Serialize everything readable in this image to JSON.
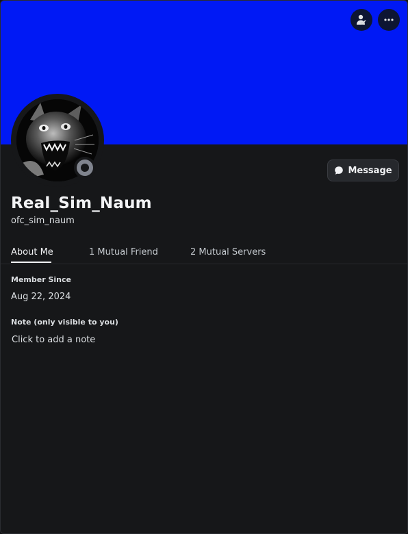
{
  "colors": {
    "banner": "#0019f5",
    "background": "#161719",
    "status_offline": "#80848e"
  },
  "banner": {
    "friend_button_icon": "add-friend-icon",
    "more_button_icon": "more-options-icon"
  },
  "profile": {
    "display_name": "Real_Sim_Naum",
    "username": "ofc_sim_naum",
    "status": "offline"
  },
  "actions": {
    "message_label": "Message",
    "message_icon": "chat-bubble-icon"
  },
  "tabs": [
    {
      "label": "About Me",
      "active": true
    },
    {
      "label": "1 Mutual Friend",
      "active": false
    },
    {
      "label": "2 Mutual Servers",
      "active": false
    }
  ],
  "about": {
    "member_since_label": "Member Since",
    "member_since_value": "Aug 22, 2024",
    "note_label": "Note (only visible to you)",
    "note_placeholder": "Click to add a note"
  }
}
